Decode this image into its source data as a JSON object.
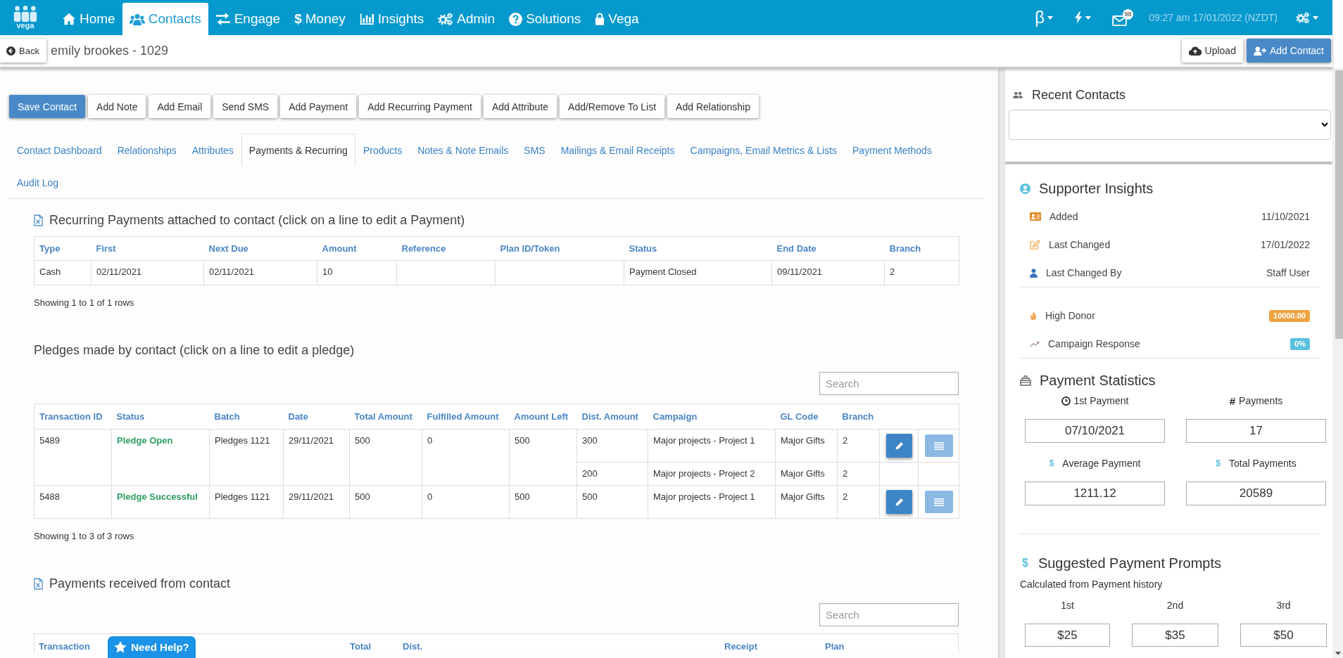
{
  "nav": {
    "logo_text": "vega",
    "items": [
      {
        "label": "Home",
        "selected": false
      },
      {
        "label": "Contacts",
        "selected": true
      },
      {
        "label": "Engage",
        "selected": false
      },
      {
        "symbol": "$",
        "label": "Money",
        "selected": false
      },
      {
        "label": "Insights",
        "selected": false
      },
      {
        "label": "Admin",
        "selected": false
      },
      {
        "label": "Solutions",
        "selected": false
      },
      {
        "label": "Vega",
        "selected": false
      }
    ],
    "beta": "β",
    "mail_badge": "98",
    "time": "09:27 am 17/01/2022 (NZDT)"
  },
  "contact": {
    "back": "Back",
    "title": "emily brookes - 1029",
    "buttons": [
      {
        "label": "Upload",
        "kind": "default"
      },
      {
        "label": "Add Contact",
        "kind": "primary"
      }
    ]
  },
  "actions": [
    {
      "label": "Save Contact",
      "kind": "primary"
    },
    {
      "label": "Add Note",
      "kind": "default"
    },
    {
      "label": "Add Email",
      "kind": "default"
    },
    {
      "label": "Send SMS",
      "kind": "default"
    },
    {
      "label": "Add Payment",
      "kind": "default"
    },
    {
      "label": "Add Recurring Payment",
      "kind": "default"
    },
    {
      "label": "Add Attribute",
      "kind": "default"
    },
    {
      "label": "Add/Remove To List",
      "kind": "default"
    },
    {
      "label": "Add Relationship",
      "kind": "default"
    }
  ],
  "tabs": [
    {
      "label": "Contact Dashboard",
      "selected": false
    },
    {
      "label": "Relationships",
      "selected": false
    },
    {
      "label": "Attributes",
      "selected": false
    },
    {
      "label": "Payments & Recurring",
      "selected": true
    },
    {
      "label": "Products",
      "selected": false
    },
    {
      "label": "Notes & Note Emails",
      "selected": false
    },
    {
      "label": "SMS",
      "selected": false
    },
    {
      "label": "Mailings & Email Receipts",
      "selected": false
    },
    {
      "label": "Campaigns, Email Metrics & Lists",
      "selected": false
    },
    {
      "label": "Payment Methods",
      "selected": false
    },
    {
      "label": "Audit Log",
      "selected": false
    }
  ],
  "recurring": {
    "title": "Recurring Payments attached to contact (click on a line to edit a Payment)",
    "columns": [
      "Type",
      "First",
      "Next Due",
      "Amount",
      "Reference",
      "Plan ID/Token",
      "Status",
      "End Date",
      "Branch"
    ],
    "rows": [
      [
        "Cash",
        "02/11/2021",
        "02/11/2021",
        "10",
        null,
        null,
        "Payment Closed",
        "09/11/2021",
        "2"
      ]
    ],
    "footer": "Showing 1 to 1 of 1 rows"
  },
  "pledges": {
    "title": "Pledges made by contact (click on a line to edit a pledge)",
    "search": {
      "placeholder": "Search"
    },
    "columns": [
      "Transaction ID",
      "Status",
      "Batch",
      "Date",
      "Total Amount",
      "Fulfilled Amount",
      "Amount Left",
      "Dist. Amount",
      "Campaign",
      "GL Code",
      "Branch"
    ],
    "rows": [
      {
        "cells": [
          "5489",
          "Pledge Open",
          "Pledges 1121",
          "29/11/2021",
          "500",
          "0",
          "500"
        ],
        "lines": [
          {
            "cells": [
              "300",
              "Major projects - Project 1",
              "Major Gifts",
              "2"
            ],
            "actions": true
          },
          {
            "cells": [
              "200",
              "Major projects - Project 2",
              "Major Gifts",
              "2"
            ],
            "actions": false
          }
        ]
      },
      {
        "cells": [
          "5488",
          "Pledge Successful",
          "Pledges 1121",
          "29/11/2021",
          "500",
          "0",
          "500"
        ],
        "lines": [
          {
            "cells": [
              "500",
              "Major projects - Project 1",
              "Major Gifts",
              "2"
            ],
            "actions": true
          }
        ]
      }
    ],
    "footer": "Showing 1 to 3 of 3 rows"
  },
  "payments": {
    "title": "Payments received from contact",
    "search": {
      "placeholder": "Search"
    },
    "columns": [
      "Transaction",
      "Total",
      "Dist.",
      "Receipt",
      "Plan"
    ]
  },
  "help": {
    "label": "Need Help?"
  },
  "sidebar": {
    "recent_contacts": {
      "title": "Recent Contacts"
    },
    "insights": {
      "title": "Supporter Insights",
      "facts": [
        {
          "label": "Added",
          "value": "11/10/2021"
        },
        {
          "label": "Last Changed",
          "value": "17/01/2022"
        },
        {
          "label": "Last Changed By",
          "value": "Staff User"
        }
      ],
      "badges": [
        {
          "label": "High Donor",
          "value": "10000.00",
          "color": "#eea440"
        },
        {
          "label": "Campaign Response",
          "value": "0%",
          "color": "#5bc0de"
        }
      ]
    },
    "payment_statistics": {
      "title": "Payment Statistics",
      "items": [
        {
          "kind": "date",
          "label": "1st Payment",
          "value": "07/10/2021"
        },
        {
          "kind": "count",
          "symbol": "#",
          "label": "Payments",
          "value": "17"
        },
        {
          "kind": "amount",
          "symbol": "$",
          "label": "Average Payment",
          "value": "1211.12"
        },
        {
          "kind": "amount",
          "symbol": "$",
          "label": "Total Payments",
          "value": "20589"
        }
      ]
    },
    "payment_prompts": {
      "symbol": "$",
      "title": "Suggested Payment Prompts",
      "note": "Calculated from Payment history",
      "items": [
        {
          "label": "1st",
          "value": "$25"
        },
        {
          "label": "2nd",
          "value": "$35"
        },
        {
          "label": "3rd",
          "value": "$50"
        }
      ]
    }
  }
}
